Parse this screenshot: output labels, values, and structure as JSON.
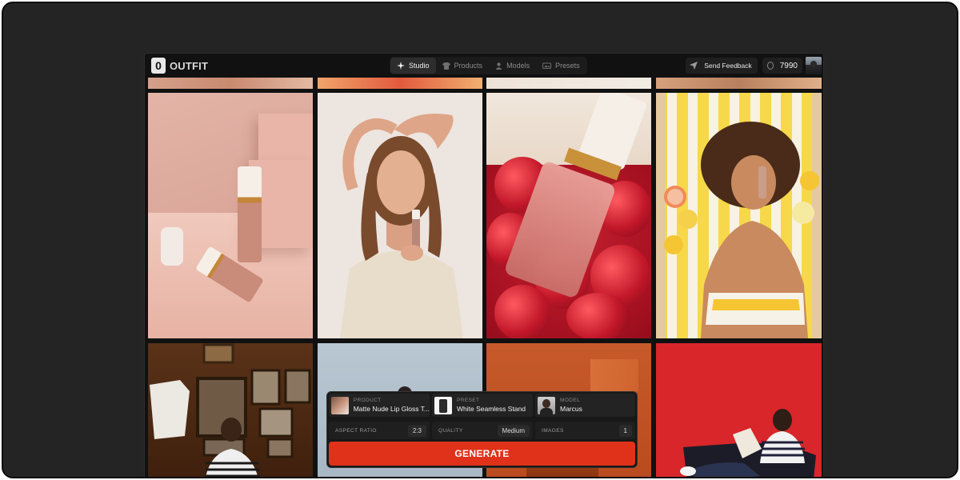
{
  "brand": {
    "mark": "0",
    "name": "OUTFIT"
  },
  "nav": {
    "items": [
      {
        "label": "Studio",
        "icon": "sparkle-icon",
        "active": true
      },
      {
        "label": "Products",
        "icon": "shirt-icon",
        "active": false
      },
      {
        "label": "Models",
        "icon": "person-icon",
        "active": false
      },
      {
        "label": "Presets",
        "icon": "image-stack-icon",
        "active": false
      }
    ]
  },
  "header": {
    "feedback_label": "Send Feedback",
    "credits": "7990"
  },
  "gallery": {
    "tiles": [
      {
        "name": "pink-lip-gloss-still-life"
      },
      {
        "name": "woman-holding-gloss"
      },
      {
        "name": "gloss-bottle-raspberries"
      },
      {
        "name": "woman-beach-towel"
      },
      {
        "name": "man-wood-wall-frames"
      },
      {
        "name": "model-blue-backdrop"
      },
      {
        "name": "orange-wall-scene"
      },
      {
        "name": "man-red-backdrop-reading"
      }
    ]
  },
  "generator": {
    "product": {
      "label": "PRODUCT",
      "value": "Matte Nude Lip Gloss T..."
    },
    "preset": {
      "label": "PRESET",
      "value": "White Seamless Stand"
    },
    "model": {
      "label": "MODEL",
      "value": "Marcus"
    },
    "aspect_ratio": {
      "label": "ASPECT RATIO",
      "value": "2:3"
    },
    "quality": {
      "label": "QUALITY",
      "value": "Medium"
    },
    "images": {
      "label": "IMAGES",
      "value": "1"
    },
    "generate_label": "GENERATE"
  }
}
